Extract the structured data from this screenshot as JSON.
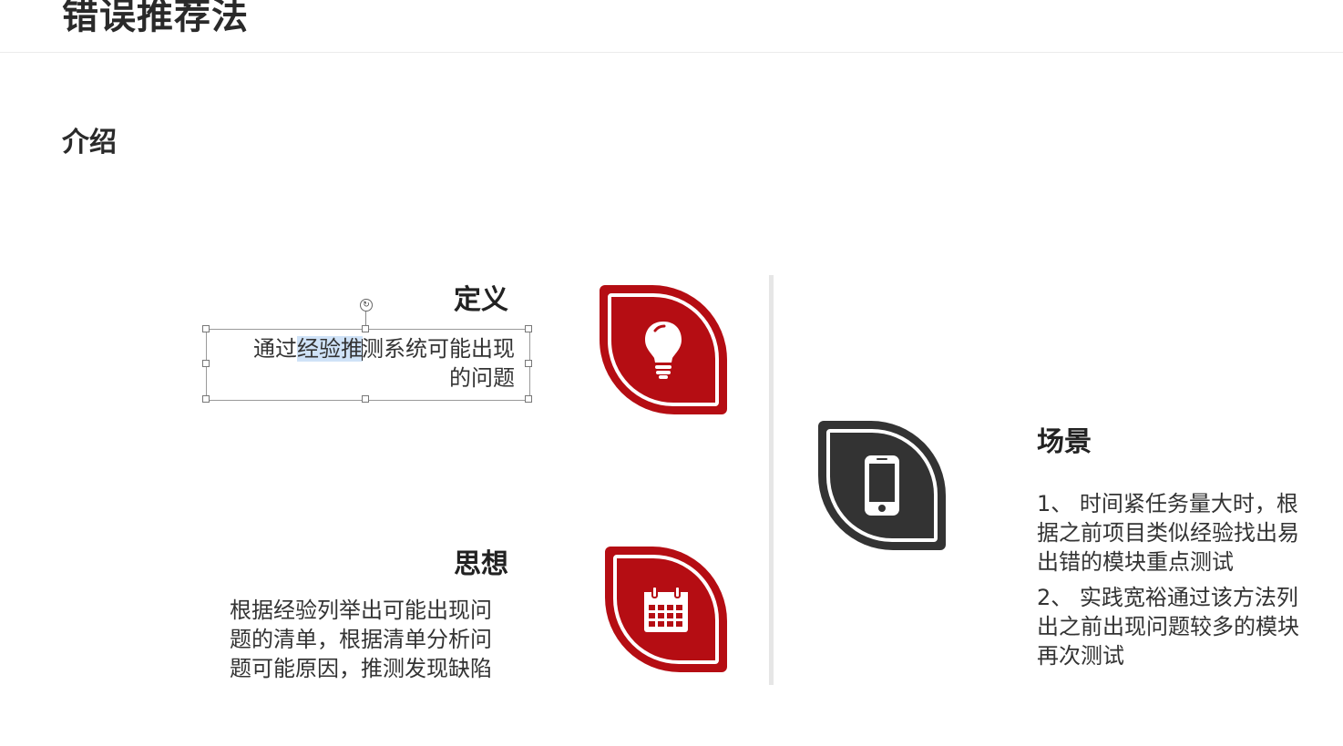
{
  "page": {
    "title": "错误推荐法",
    "section": "介绍"
  },
  "definition": {
    "heading": "定义",
    "text_before": "通过",
    "text_selected_a": "经验",
    "text_selected_b": "推",
    "text_after": "测系统可能出现",
    "text_line2": "的问题",
    "icon": "lightbulb-icon",
    "color": "#b50d13"
  },
  "idea": {
    "heading": "思想",
    "lines": [
      "根据经验列举出可能出现问",
      "题的清单，根据清单分析问",
      "题可能原因，推测发现缺陷"
    ],
    "icon": "calendar-icon",
    "color": "#b50d13"
  },
  "scenario": {
    "heading": "场景",
    "item1_lines": [
      "1、 时间紧任务量大时，根",
      "据之前项目类似经验找出易",
      "出错的模块重点测试"
    ],
    "item2_lines": [
      "2、 实践宽裕通过该方法列",
      "出之前出现问题较多的模块",
      "再次测试"
    ],
    "icon": "smartphone-icon",
    "color": "#333333"
  },
  "colors": {
    "accent_red": "#b50d13",
    "dark": "#333333",
    "selection_highlight": "#cfe2f7"
  }
}
